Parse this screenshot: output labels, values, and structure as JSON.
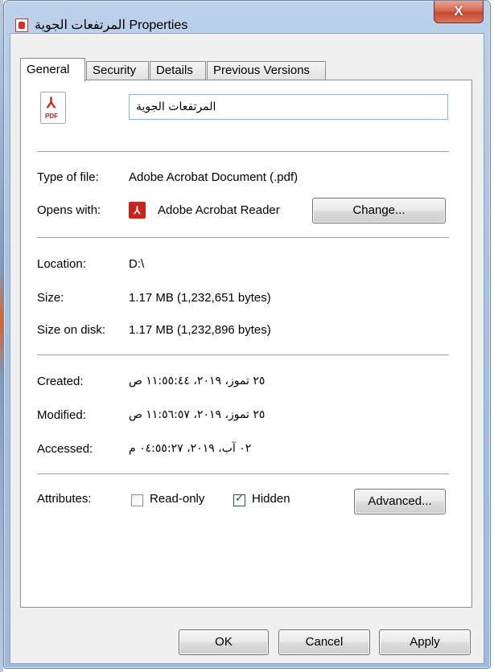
{
  "window": {
    "title": "المرتفعات الجوية Properties",
    "close_label": "X"
  },
  "tabs": [
    {
      "label": "General"
    },
    {
      "label": "Security"
    },
    {
      "label": "Details"
    },
    {
      "label": "Previous Versions"
    }
  ],
  "file": {
    "icon": "pdf-file-icon",
    "name": "المرتفعات الجوية"
  },
  "type_section": {
    "type_label": "Type of file:",
    "type_value": "Adobe Acrobat Document (.pdf)",
    "opens_label": "Opens with:",
    "opens_value": "Adobe Acrobat Reader",
    "change_label": "Change..."
  },
  "location_section": {
    "location_label": "Location:",
    "location_value": "D:\\",
    "size_label": "Size:",
    "size_value": "1.17 MB (1,232,651 bytes)",
    "size_disk_label": "Size on disk:",
    "size_disk_value": "1.17 MB (1,232,896 bytes)"
  },
  "dates_section": {
    "created_label": "Created:",
    "created_value": "٢٥ تموز، ٢٠١٩، ١١:٥٥:٤٤ ص",
    "modified_label": "Modified:",
    "modified_value": "٢٥ تموز، ٢٠١٩، ١١:٥٦:٥٧ ص",
    "accessed_label": "Accessed:",
    "accessed_value": "٠٢ آب، ٢٠١٩، ٠٤:٥٥:٢٧ م"
  },
  "attributes": {
    "label": "Attributes:",
    "readonly_label": "Read-only",
    "readonly_checked": false,
    "hidden_label": "Hidden",
    "hidden_checked": true,
    "advanced_label": "Advanced..."
  },
  "footer": {
    "ok_label": "OK",
    "cancel_label": "Cancel",
    "apply_label": "Apply"
  }
}
